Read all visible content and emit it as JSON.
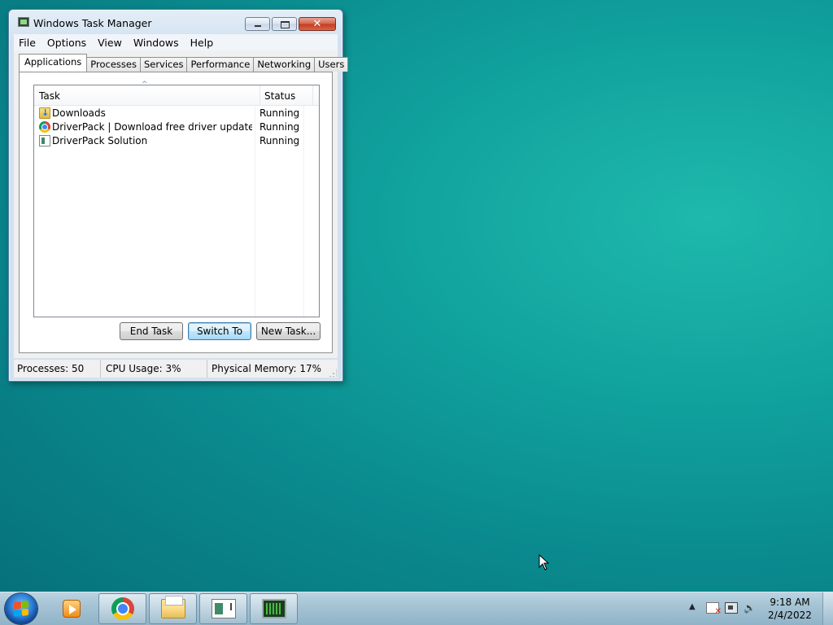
{
  "window": {
    "title": "Windows Task Manager",
    "caption_buttons": {
      "minimize": "minimize-icon",
      "maximize": "maximize-icon",
      "close": "✕"
    }
  },
  "menu": [
    "File",
    "Options",
    "View",
    "Windows",
    "Help"
  ],
  "tabs": [
    "Applications",
    "Processes",
    "Services",
    "Performance",
    "Networking",
    "Users"
  ],
  "active_tab": "Applications",
  "table": {
    "columns": [
      "Task",
      "Status"
    ],
    "sort_indicator": "^",
    "rows": [
      {
        "icon": "downloads-folder-icon",
        "task": "Downloads",
        "status": "Running"
      },
      {
        "icon": "chrome-icon",
        "task": "DriverPack | Download free driver update softw...",
        "status": "Running"
      },
      {
        "icon": "driverpack-icon",
        "task": "DriverPack Solution",
        "status": "Running"
      }
    ]
  },
  "buttons": {
    "end_task": "End Task",
    "switch_to": "Switch To",
    "new_task": "New Task..."
  },
  "statusbar": {
    "processes": "Processes: 50",
    "cpu": "CPU Usage: 3%",
    "memory": "Physical Memory: 17%"
  },
  "taskbar": {
    "start": "start-orb-icon",
    "apps": [
      "media-player-icon",
      "chrome-icon",
      "explorer-icon",
      "driverpack-icon",
      "task-manager-icon"
    ],
    "tray_arrow": "▲",
    "volume_glyph": "🔊",
    "clock": {
      "time": "9:18 AM",
      "date": "2/4/2022"
    }
  },
  "colors": {
    "desktop": "#11a39e",
    "taskbar": "#a4c2d3",
    "close_button": "#c13b22",
    "default_button": "#3c7fb1"
  }
}
